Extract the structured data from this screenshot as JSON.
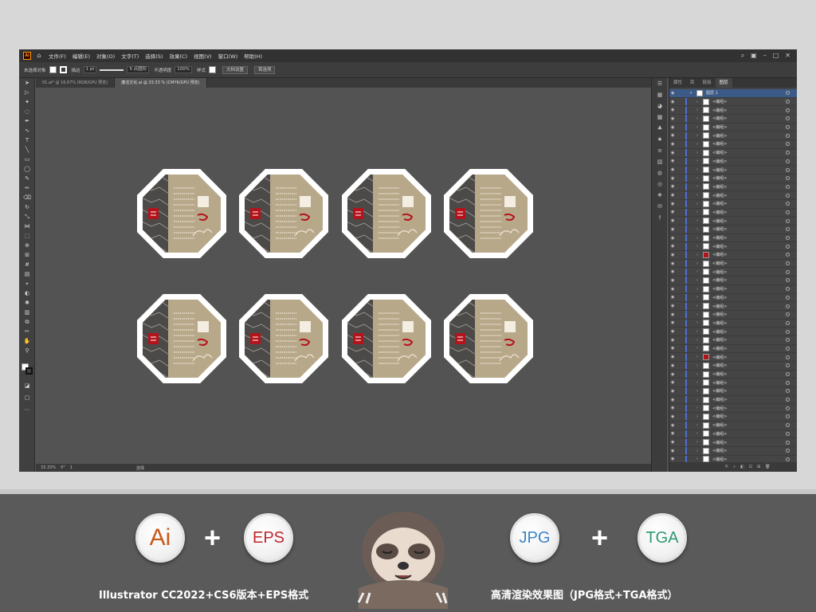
{
  "menu": {
    "app_logo": "Ai",
    "items": [
      "文件(F)",
      "编辑(E)",
      "对象(O)",
      "文字(T)",
      "选择(S)",
      "效果(C)",
      "视图(V)",
      "窗口(W)",
      "帮助(H)"
    ]
  },
  "control_bar": {
    "selection_label": "未选择对象",
    "stroke_label": "描边",
    "stroke_width": "1 pt",
    "brush": "5 点圆形",
    "opacity_label": "不透明度",
    "opacity": "100%",
    "style_label": "样式",
    "doc_setup": "文档设置",
    "prefs": "首选项"
  },
  "tabs": [
    {
      "label": "01.ai* @ 16.67% (RGB/GPU 预览)",
      "active": false
    },
    {
      "label": "廉洁文化.ai @ 33.33 % (CMYK/GPU 预览)",
      "active": true
    }
  ],
  "status": {
    "zoom": "33.33%",
    "angle": "0°",
    "artboard": "1",
    "tool": "选择"
  },
  "layers_panel": {
    "tabs": [
      "属性",
      "库",
      "链接",
      "图层"
    ],
    "active_tab": "图层",
    "top_layer": "图层 1",
    "item_name": "<编组>",
    "item_count": 43,
    "red_rows": [
      18,
      30
    ]
  },
  "badges": {
    "ai": "Ai",
    "eps": "EPS",
    "jpg": "JPG",
    "tga": "TGA",
    "plus": "+"
  },
  "captions": {
    "left": "Illustrator CC2022+CS6版本+EPS格式",
    "right": "高清渲染效果图（JPG格式+TGA格式）"
  },
  "colors": {
    "red": "#b3141b",
    "tan": "#b8a88a",
    "dark": "#4c4a48",
    "jpg_blue": "#3c84c8",
    "tga_green": "#2c9a6e"
  }
}
